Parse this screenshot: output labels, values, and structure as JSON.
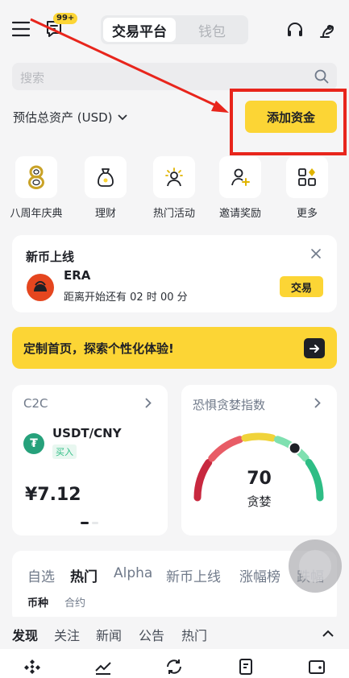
{
  "header": {
    "notification_count": "99+",
    "segments": {
      "exchange": "交易平台",
      "wallet": "钱包"
    }
  },
  "search": {
    "placeholder": "搜索"
  },
  "assets": {
    "label": "预估总资产 (USD)",
    "add_funds": "添加资金"
  },
  "shortcuts": [
    {
      "label": "八周年庆典",
      "icon": "anniversary-8-icon"
    },
    {
      "label": "理财",
      "icon": "money-bag-icon"
    },
    {
      "label": "热门活动",
      "icon": "person-sparkle-icon"
    },
    {
      "label": "邀请奖励",
      "icon": "person-add-icon"
    },
    {
      "label": "更多",
      "icon": "grid-more-icon"
    }
  ],
  "new_listing": {
    "title": "新币上线",
    "coin": "ERA",
    "countdown": "距离开始还有 02 时 00 分",
    "trade_label": "交易"
  },
  "promo": {
    "text": "定制首页，探索个性化体验!"
  },
  "c2c": {
    "title": "C2C",
    "pair": "USDT/CNY",
    "tag": "买入",
    "price": "¥7.12"
  },
  "fear_greed": {
    "title": "恐惧贪婪指数",
    "value": "70",
    "label": "贪婪",
    "level": 70
  },
  "market_tabs": [
    "自选",
    "热门",
    "Alpha",
    "新币上线",
    "涨幅榜",
    "跌幅"
  ],
  "market_subtabs": [
    "币种",
    "合约"
  ],
  "discover_tabs": [
    "发现",
    "关注",
    "新闻",
    "公告",
    "热门"
  ],
  "colors": {
    "accent": "#FCD535",
    "annotation": "#E8251C",
    "up": "#2EBD85",
    "down": "#C8283F"
  }
}
